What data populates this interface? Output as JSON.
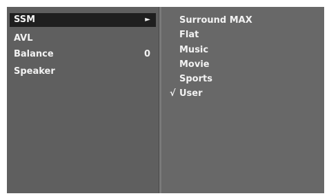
{
  "menu": {
    "items": [
      {
        "label": "SSM",
        "arrow": "►"
      },
      {
        "label": "AVL"
      },
      {
        "label": "Balance",
        "value": "0"
      },
      {
        "label": "Speaker"
      }
    ]
  },
  "submenu": {
    "options": [
      {
        "label": "Surround MAX",
        "check": ""
      },
      {
        "label": "Flat",
        "check": ""
      },
      {
        "label": "Music",
        "check": ""
      },
      {
        "label": "Movie",
        "check": ""
      },
      {
        "label": "Sports",
        "check": ""
      },
      {
        "label": "User",
        "check": "√"
      }
    ]
  }
}
